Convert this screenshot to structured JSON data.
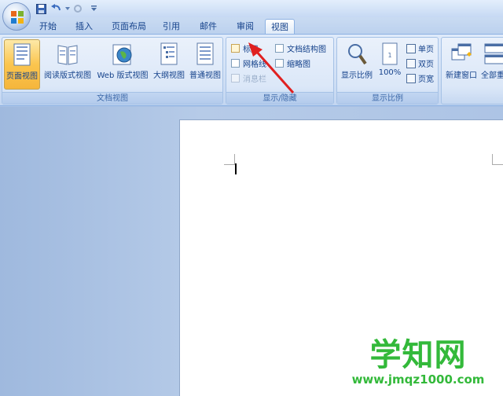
{
  "tabs": [
    "开始",
    "插入",
    "页面布局",
    "引用",
    "邮件",
    "审阅",
    "视图"
  ],
  "active_tab": "视图",
  "groups": {
    "document_views": {
      "label": "文档视图",
      "buttons": [
        "页面视图",
        "阅读版式视图",
        "Web 版式视图",
        "大纲视图",
        "普通视图"
      ]
    },
    "show_hide": {
      "label": "显示/隐藏",
      "checkboxes": [
        "标尺",
        "网格线",
        "消息栏",
        "文档结构图",
        "缩略图"
      ]
    },
    "zoom": {
      "label": "显示比例",
      "buttons": [
        "显示比例",
        "100%"
      ],
      "small_buttons": [
        "单页",
        "双页",
        "页宽"
      ]
    },
    "window": {
      "buttons": [
        "新建窗口",
        "全部重"
      ]
    }
  },
  "watermark": {
    "title": "学知网",
    "url": "www.jmqz1000.com"
  },
  "colors": {
    "accent": "#15428b",
    "watermark": "#33b93a",
    "arrow": "#e02020"
  }
}
